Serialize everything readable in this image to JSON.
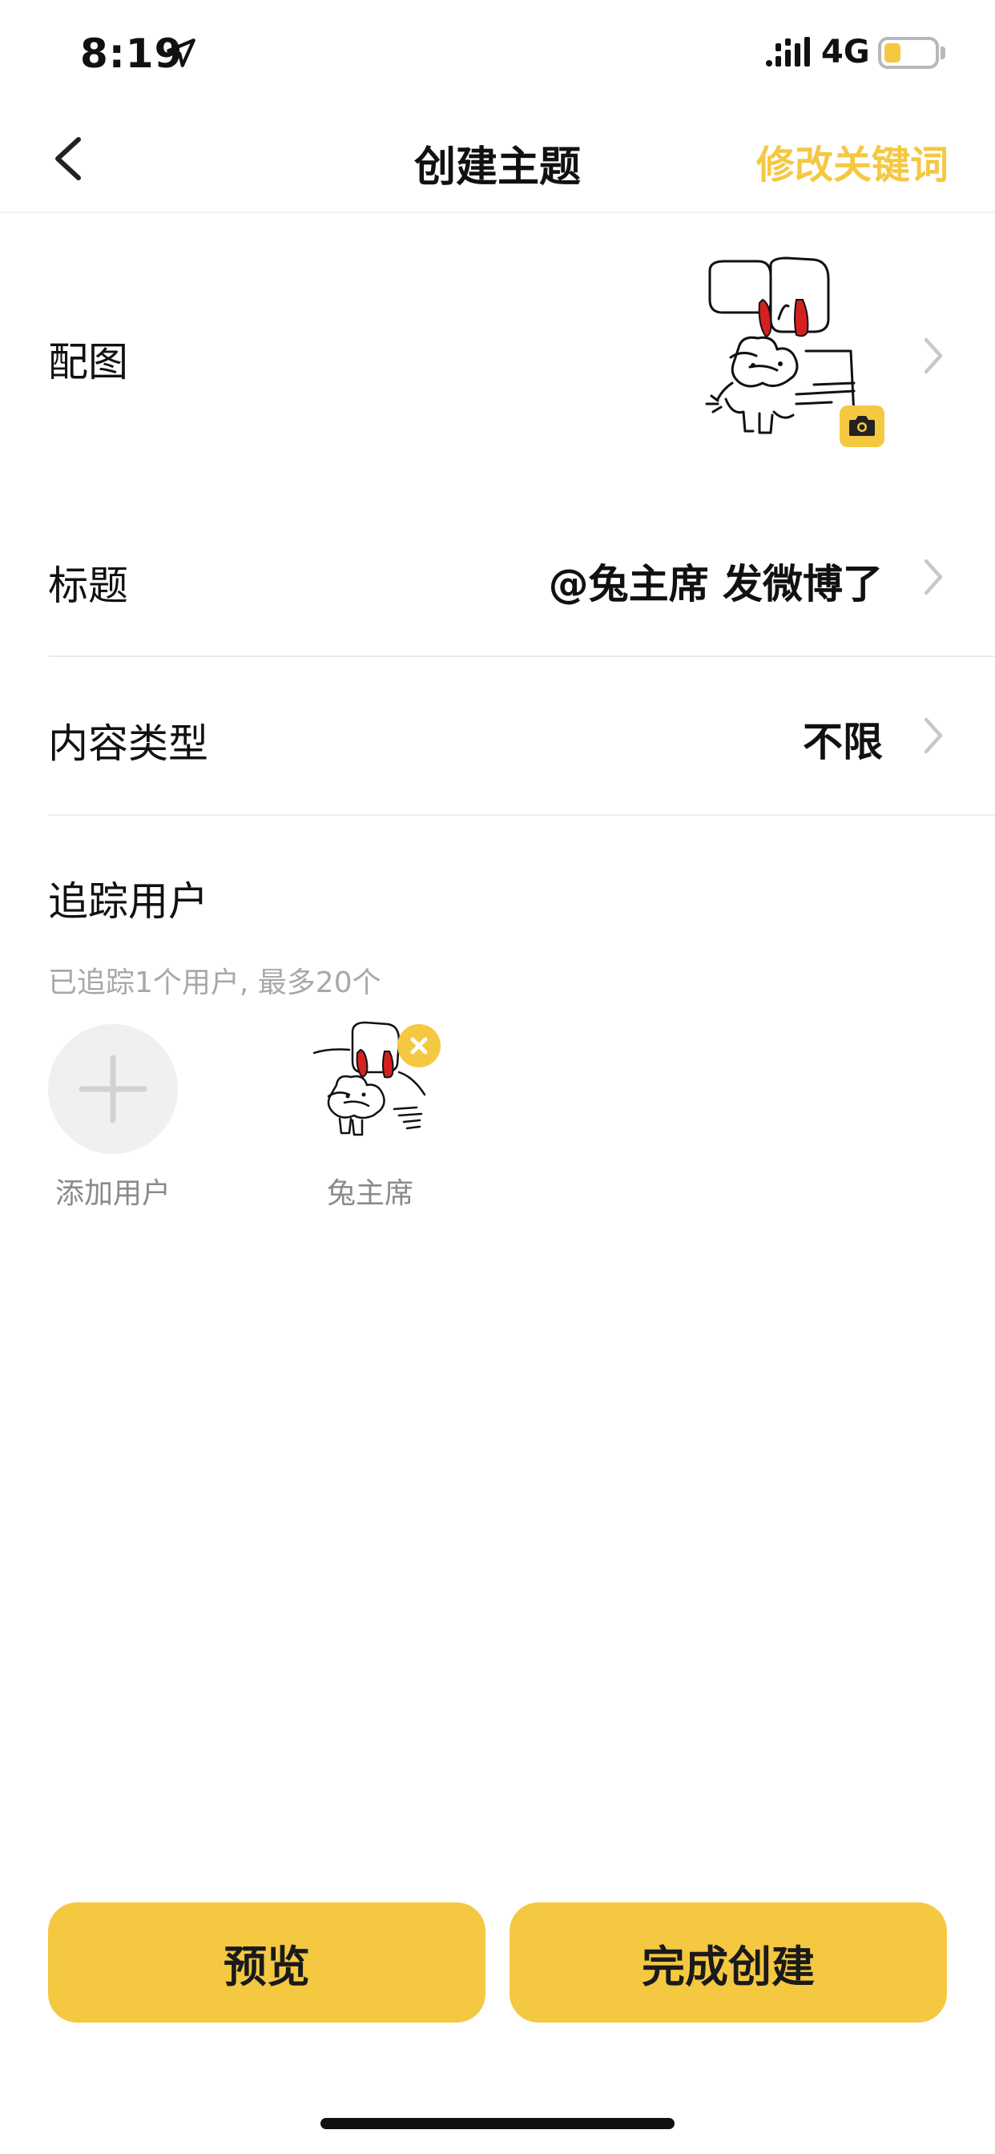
{
  "status_bar": {
    "time": "8:19",
    "network": "4G",
    "battery_level": 0.3
  },
  "nav": {
    "title": "创建主题",
    "action_label": "修改关键词",
    "back_icon": "chevron-left-icon"
  },
  "form": {
    "cover": {
      "label": "配图",
      "camera_icon": "camera-icon"
    },
    "title": {
      "label": "标题",
      "value": "@兔主席 发微博了"
    },
    "content_type": {
      "label": "内容类型",
      "value": "不限"
    }
  },
  "follow": {
    "heading": "追踪用户",
    "hint": "已追踪1个用户, 最多20个",
    "add_label": "添加用户",
    "users": [
      {
        "name": "兔主席"
      }
    ]
  },
  "actions": {
    "preview_label": "预览",
    "create_label": "完成创建"
  },
  "colors": {
    "accent": "#f5c842",
    "text": "#111111",
    "muted": "#a8a8a8",
    "divider": "#ececec"
  }
}
